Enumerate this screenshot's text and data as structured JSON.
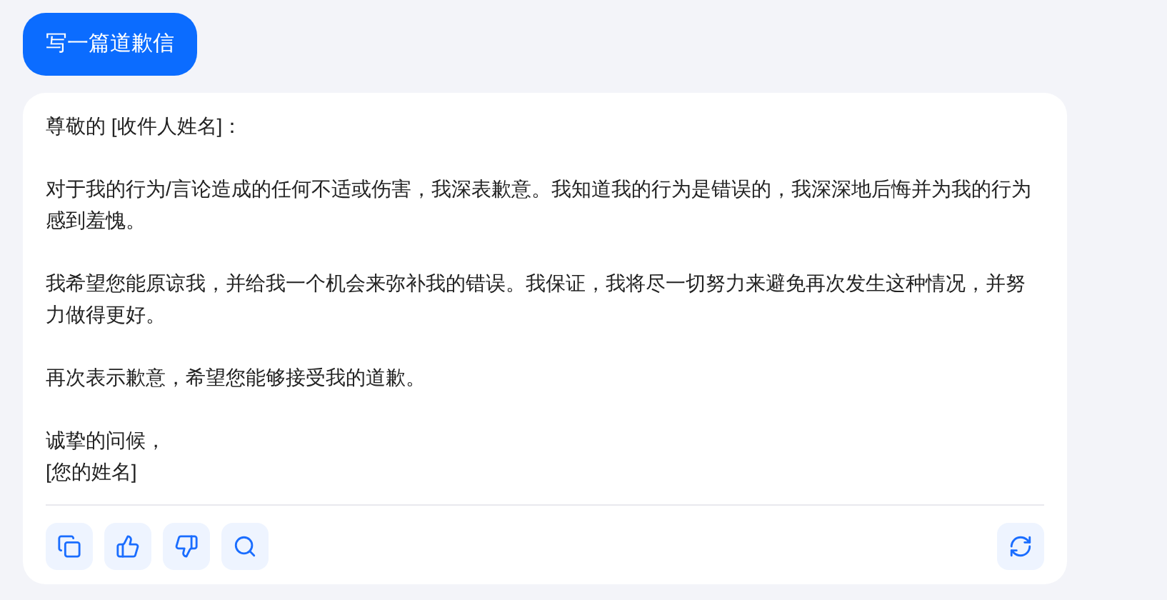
{
  "prompt_button": {
    "label": "写一篇道歉信"
  },
  "response": {
    "paragraphs": [
      {
        "lines": [
          "尊敬的 [收件人姓名]："
        ]
      },
      {
        "lines": [
          "对于我的行为/言论造成的任何不适或伤害，我深表歉意。我知道我的行为是错误的，我深深地后悔并为我的行为感到羞愧。"
        ]
      },
      {
        "lines": [
          "我希望您能原谅我，并给我一个机会来弥补我的错误。我保证，我将尽一切努力来避免再次发生这种情况，并努力做得更好。"
        ]
      },
      {
        "lines": [
          "再次表示歉意，希望您能够接受我的道歉。"
        ]
      },
      {
        "lines": [
          "诚挚的问候，",
          "[您的姓名]"
        ]
      }
    ]
  },
  "actions": [
    {
      "kind": "copy"
    },
    {
      "kind": "like"
    },
    {
      "kind": "dislike"
    },
    {
      "kind": "search"
    },
    {
      "kind": "regenerate"
    }
  ]
}
